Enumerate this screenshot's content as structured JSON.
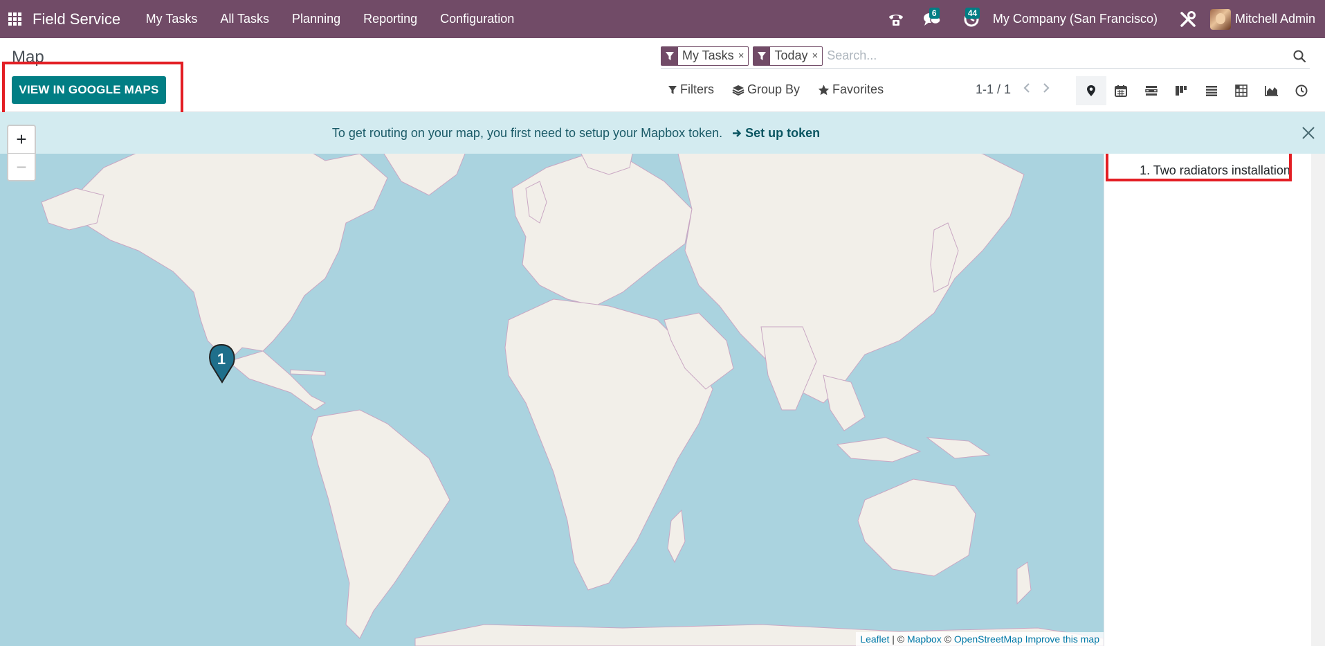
{
  "navbar": {
    "app_name": "Field Service",
    "menu": [
      "My Tasks",
      "All Tasks",
      "Planning",
      "Reporting",
      "Configuration"
    ],
    "messages_count": "6",
    "activities_count": "44",
    "company": "My Company (San Francisco)",
    "user": "Mitchell Admin"
  },
  "control_panel": {
    "breadcrumb": "Map",
    "google_maps_button": "VIEW IN GOOGLE MAPS",
    "facets": [
      {
        "value": "My Tasks",
        "remove": "×"
      },
      {
        "value": "Today",
        "remove": "×"
      }
    ],
    "search_placeholder": "Search...",
    "filters_label": "Filters",
    "group_by_label": "Group By",
    "favorites_label": "Favorites",
    "pager": "1-1 / 1",
    "views": [
      "map-view-icon",
      "calendar-view-icon",
      "gantt-view-icon",
      "kanban-view-icon",
      "list-view-icon",
      "pivot-view-icon",
      "graph-view-icon",
      "activity-view-icon"
    ]
  },
  "alert": {
    "message": "To get routing on your map, you first need to setup your Mapbox token.",
    "link": "Set up token"
  },
  "map": {
    "zoom_in": "+",
    "zoom_out": "−",
    "marker_label": "1",
    "attribution": {
      "leaflet": "Leaflet",
      "sep": " | © ",
      "mapbox": "Mapbox",
      "sep2": " © ",
      "osm": "OpenStreetMap",
      "improve": "Improve this map"
    }
  },
  "side_panel": {
    "records": [
      "1. Two radiators installation"
    ]
  },
  "colors": {
    "brand": "#714b67",
    "accent": "#017e84",
    "ocean": "#aad3df",
    "land": "#f2efe9",
    "highlight": "#e31e24"
  }
}
